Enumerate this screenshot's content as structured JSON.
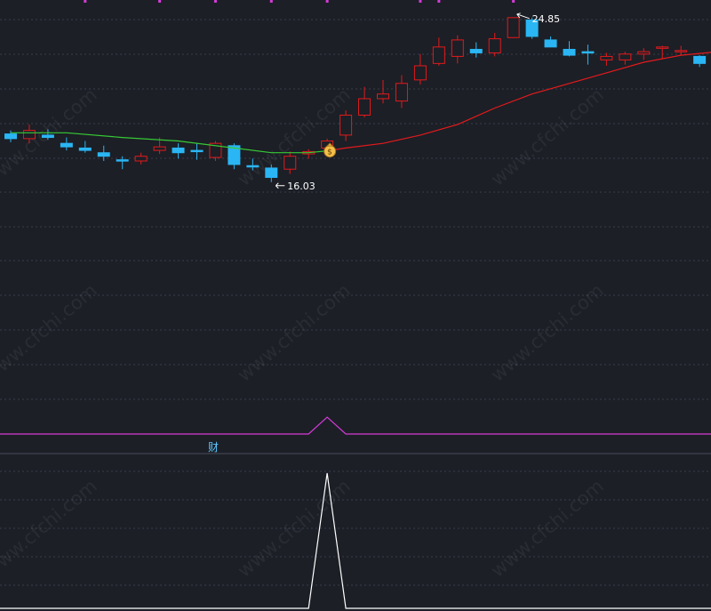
{
  "colors": {
    "background": "#1c1f26",
    "grid": "#3a3e49",
    "up_candle": "#e31a1c",
    "down_candle": "#2ab6f4",
    "ma_green": "#36c935",
    "ma_red": "#e31a1c",
    "signal_line": "#d53ad8",
    "indicator_line": "#ffffff",
    "marker_dot": "#d53ad8",
    "label": "#ffffff",
    "sub_label": "#5cc8ff"
  },
  "watermark": "www.cfchi.com",
  "chart_data": [
    {
      "type": "candlestick",
      "name": "main-price-panel",
      "ylim": [
        8.0,
        25.6
      ],
      "grid": true,
      "annotations": {
        "high_label": "24.85",
        "low_label": "16.03",
        "signal_icon": "money-bag-icon",
        "signal_index": 17
      },
      "candles": [
        {
          "o": 19.9,
          "h": 20.05,
          "l": 19.55,
          "c": 19.7
        },
        {
          "o": 19.7,
          "h": 20.3,
          "l": 19.5,
          "c": 20.05
        },
        {
          "o": 19.85,
          "h": 20.1,
          "l": 19.65,
          "c": 19.75
        },
        {
          "o": 19.5,
          "h": 19.75,
          "l": 19.2,
          "c": 19.35
        },
        {
          "o": 19.3,
          "h": 19.6,
          "l": 19.1,
          "c": 19.2
        },
        {
          "o": 19.1,
          "h": 19.4,
          "l": 18.75,
          "c": 18.95
        },
        {
          "o": 18.8,
          "h": 18.95,
          "l": 18.4,
          "c": 18.75
        },
        {
          "o": 18.75,
          "h": 19.1,
          "l": 18.6,
          "c": 18.95
        },
        {
          "o": 19.2,
          "h": 19.75,
          "l": 19.05,
          "c": 19.35
        },
        {
          "o": 19.3,
          "h": 19.5,
          "l": 18.85,
          "c": 19.1
        },
        {
          "o": 19.2,
          "h": 19.5,
          "l": 18.8,
          "c": 19.15
        },
        {
          "o": 18.9,
          "h": 19.6,
          "l": 18.75,
          "c": 19.5
        },
        {
          "o": 19.4,
          "h": 19.5,
          "l": 18.4,
          "c": 18.6
        },
        {
          "o": 18.55,
          "h": 18.85,
          "l": 18.35,
          "c": 18.5
        },
        {
          "o": 18.45,
          "h": 18.6,
          "l": 17.85,
          "c": 18.05
        },
        {
          "o": 18.4,
          "h": 19.15,
          "l": 18.2,
          "c": 18.95
        },
        {
          "o": 19.05,
          "h": 19.25,
          "l": 18.85,
          "c": 19.15
        },
        {
          "o": 19.3,
          "h": 19.7,
          "l": 19.2,
          "c": 19.6
        },
        {
          "o": 19.85,
          "h": 20.9,
          "l": 19.6,
          "c": 20.7
        },
        {
          "o": 20.7,
          "h": 21.9,
          "l": 20.6,
          "c": 21.4
        },
        {
          "o": 21.4,
          "h": 22.2,
          "l": 21.2,
          "c": 21.6
        },
        {
          "o": 21.3,
          "h": 22.4,
          "l": 21.0,
          "c": 22.05
        },
        {
          "o": 22.2,
          "h": 23.3,
          "l": 22.0,
          "c": 22.8
        },
        {
          "o": 22.9,
          "h": 24.0,
          "l": 22.8,
          "c": 23.6
        },
        {
          "o": 23.2,
          "h": 24.1,
          "l": 22.9,
          "c": 23.9
        },
        {
          "o": 23.5,
          "h": 23.8,
          "l": 23.15,
          "c": 23.35
        },
        {
          "o": 23.35,
          "h": 24.2,
          "l": 23.2,
          "c": 23.95
        },
        {
          "o": 24.0,
          "h": 24.85,
          "l": 24.0,
          "c": 24.85
        },
        {
          "o": 24.75,
          "h": 24.85,
          "l": 23.95,
          "c": 24.05
        },
        {
          "o": 23.9,
          "h": 24.05,
          "l": 23.6,
          "c": 23.6
        },
        {
          "o": 23.5,
          "h": 23.85,
          "l": 23.2,
          "c": 23.25
        },
        {
          "o": 23.4,
          "h": 23.7,
          "l": 22.85,
          "c": 23.35
        },
        {
          "o": 23.05,
          "h": 23.35,
          "l": 22.8,
          "c": 23.2
        },
        {
          "o": 23.05,
          "h": 23.4,
          "l": 22.85,
          "c": 23.3
        },
        {
          "o": 23.3,
          "h": 23.55,
          "l": 23.05,
          "c": 23.4
        },
        {
          "o": 23.55,
          "h": 23.65,
          "l": 23.1,
          "c": 23.6
        },
        {
          "o": 23.45,
          "h": 23.65,
          "l": 23.25,
          "c": 23.45
        },
        {
          "o": 23.2,
          "h": 23.25,
          "l": 22.75,
          "c": 22.9
        },
        {
          "o": 22.8,
          "h": 23.35,
          "l": 22.75,
          "c": 23.1
        }
      ],
      "ma_line": [
        {
          "index": 0,
          "value": 19.95
        },
        {
          "index": 3,
          "value": 19.95
        },
        {
          "index": 6,
          "value": 19.75
        },
        {
          "index": 9,
          "value": 19.6
        },
        {
          "index": 12,
          "value": 19.3
        },
        {
          "index": 14,
          "value": 19.1
        },
        {
          "index": 16,
          "value": 19.1
        },
        {
          "index": 17,
          "value": 19.18
        },
        {
          "index": 18,
          "value": 19.3
        },
        {
          "index": 20,
          "value": 19.5
        },
        {
          "index": 22,
          "value": 19.85
        },
        {
          "index": 24,
          "value": 20.3
        },
        {
          "index": 26,
          "value": 21.0
        },
        {
          "index": 28,
          "value": 21.6
        },
        {
          "index": 30,
          "value": 22.05
        },
        {
          "index": 32,
          "value": 22.5
        },
        {
          "index": 34,
          "value": 22.95
        },
        {
          "index": 36,
          "value": 23.25
        },
        {
          "index": 38,
          "value": 23.4
        }
      ],
      "ma_color_switch_index": 17,
      "top_markers": [
        4,
        8,
        11,
        14,
        17,
        22,
        23,
        27
      ]
    },
    {
      "type": "line",
      "name": "signal-panel",
      "label": "",
      "values": [
        0,
        0,
        0,
        0,
        0,
        0,
        0,
        0,
        0,
        0,
        0,
        0,
        0,
        0,
        0,
        0,
        0,
        1,
        0,
        0,
        0,
        0,
        0,
        0,
        0,
        0,
        0,
        0,
        0,
        0,
        0,
        0,
        0,
        0,
        0,
        0,
        0,
        0,
        0
      ],
      "ylim": [
        0,
        1
      ]
    },
    {
      "type": "line",
      "name": "indicator-panel",
      "label": "财",
      "values": [
        0,
        0,
        0,
        0,
        0,
        0,
        0,
        0,
        0,
        0,
        0,
        0,
        0,
        0,
        0,
        0,
        0,
        1,
        0,
        0,
        0,
        0,
        0,
        0,
        0,
        0,
        0,
        0,
        0,
        0,
        0,
        0,
        0,
        0,
        0,
        0,
        0,
        0,
        0
      ],
      "ylim": [
        0,
        1
      ],
      "grid": true
    }
  ]
}
